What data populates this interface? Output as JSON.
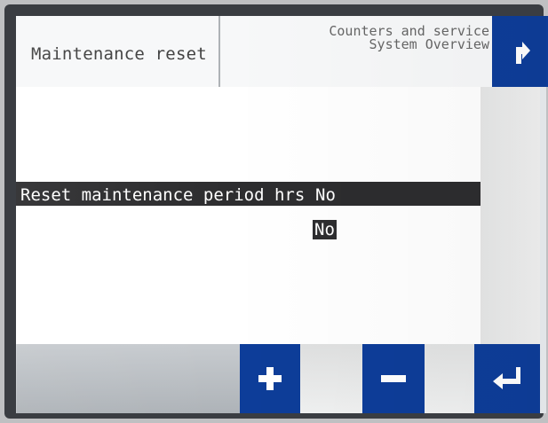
{
  "header": {
    "title": "Maintenance reset",
    "context_line_1": "Counters and service",
    "context_line_2": "System Overview"
  },
  "menu": {
    "row_label": "Reset maintenance period hrs",
    "current_value": "No",
    "selected_option": "No"
  },
  "icons": {
    "back": "back-arrow-icon",
    "plus": "plus-icon",
    "minus": "minus-icon",
    "enter": "enter-icon"
  },
  "colors": {
    "button_blue": "#0d3d99",
    "selection_bar": "#2d2d2f"
  }
}
